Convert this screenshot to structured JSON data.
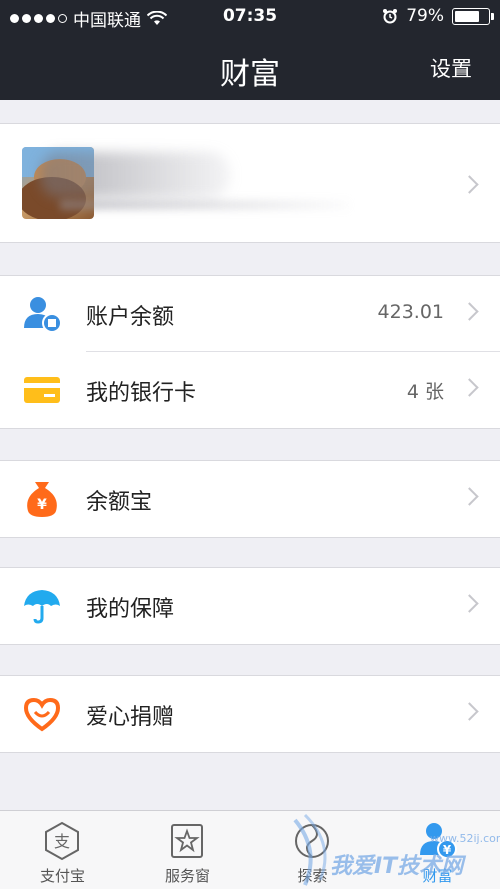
{
  "status_bar": {
    "carrier": "中国联通",
    "time": "07:35",
    "battery_text": "79%",
    "battery_level": 0.79
  },
  "nav": {
    "title": "财富",
    "settings": "设置"
  },
  "account_group": [
    {
      "label": "账户余额",
      "value": "423.01",
      "icon": "account-balance-icon"
    },
    {
      "label": "我的银行卡",
      "value": "4 张",
      "icon": "bank-card-icon"
    }
  ],
  "yuebao": {
    "label": "余额宝",
    "icon": "money-bag-icon"
  },
  "insurance": {
    "label": "我的保障",
    "icon": "umbrella-icon"
  },
  "charity": {
    "label": "爱心捐赠",
    "icon": "heart-icon"
  },
  "tabs": [
    {
      "label": "支付宝",
      "icon": "alipay-icon"
    },
    {
      "label": "服务窗",
      "icon": "service-window-icon"
    },
    {
      "label": "探索",
      "icon": "explore-icon"
    },
    {
      "label": "财富",
      "icon": "wealth-icon",
      "active": true
    }
  ],
  "watermark": {
    "text": "我爱IT技术网",
    "sub": "www.52ij.com"
  },
  "colors": {
    "nav_bg": "#23262e",
    "accent_blue": "#3399ee",
    "orange": "#ff6a1a",
    "yellow": "#ffc21a"
  }
}
